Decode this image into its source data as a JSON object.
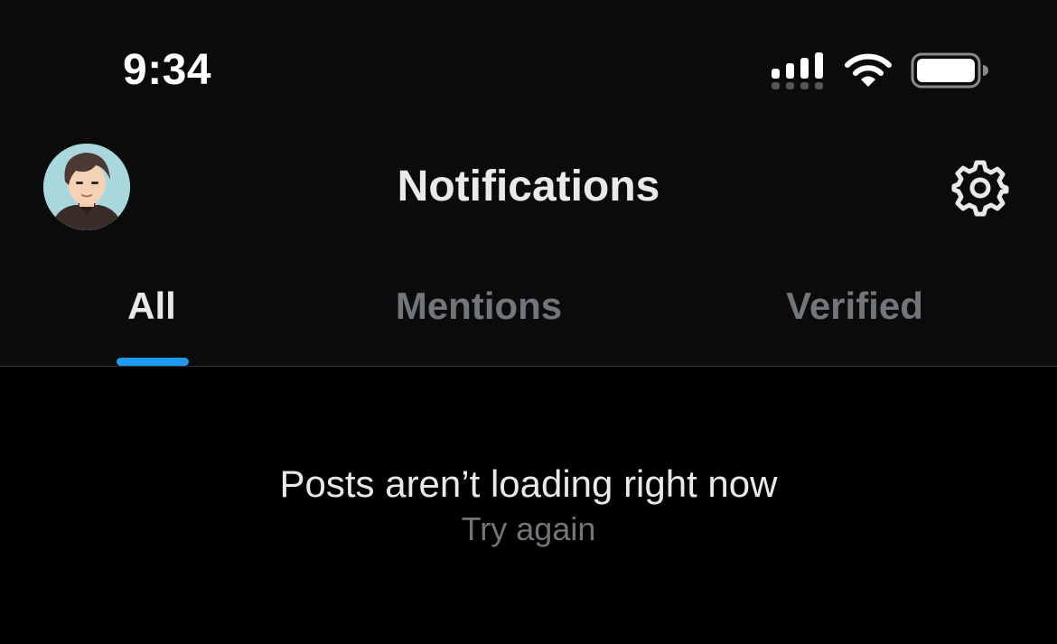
{
  "status_bar": {
    "time": "9:34",
    "icons": [
      "cellular-signal-icon",
      "wifi-icon",
      "battery-icon"
    ]
  },
  "header": {
    "avatar": "user-avatar",
    "title": "Notifications",
    "settings_icon": "gear-icon"
  },
  "tabs": [
    {
      "label": "All",
      "active": true
    },
    {
      "label": "Mentions",
      "active": false
    },
    {
      "label": "Verified",
      "active": false
    }
  ],
  "empty_state": {
    "message": "Posts aren’t loading right now",
    "retry_label": "Try again"
  },
  "colors": {
    "background": "#000000",
    "header_background": "#0b0b0b",
    "text_primary": "#e7e9ea",
    "text_secondary": "#71767b",
    "accent": "#1d9bf0",
    "divider": "#2f3336"
  }
}
